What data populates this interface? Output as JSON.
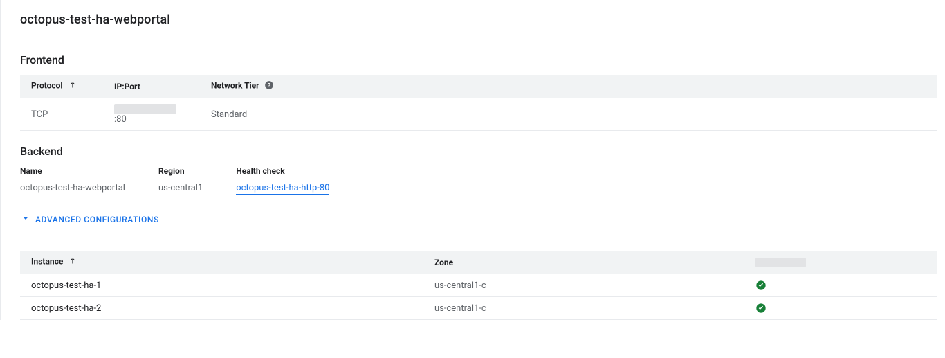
{
  "title": "octopus-test-ha-webportal",
  "frontend": {
    "heading": "Frontend",
    "columns": {
      "protocol": "Protocol",
      "ipport": "IP:Port",
      "tier": "Network Tier"
    },
    "rows": [
      {
        "protocol": "TCP",
        "ip_redacted": "xxxxxxxxxxxxxx",
        "port": ":80",
        "tier": "Standard"
      }
    ]
  },
  "backend": {
    "heading": "Backend",
    "labels": {
      "name": "Name",
      "region": "Region",
      "health": "Health check"
    },
    "name": "octopus-test-ha-webportal",
    "region": "us-central1",
    "health_check": "octopus-test-ha-http-80",
    "advanced_label": "ADVANCED CONFIGURATIONS"
  },
  "instances": {
    "columns": {
      "instance": "Instance",
      "zone": "Zone",
      "status_redacted": "xxxxxxxxxxxx"
    },
    "rows": [
      {
        "instance": "octopus-test-ha-1",
        "zone": "us-central1-c",
        "healthy": true
      },
      {
        "instance": "octopus-test-ha-2",
        "zone": "us-central1-c",
        "healthy": true
      }
    ]
  }
}
